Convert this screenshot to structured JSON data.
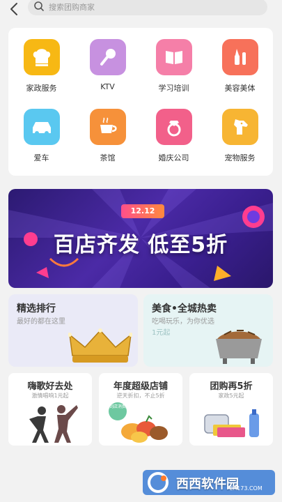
{
  "search": {
    "placeholder": "搜索团购商家"
  },
  "categories": [
    {
      "label": "家政服务",
      "icon": "chef-hat-icon",
      "color": "#f7b814"
    },
    {
      "label": "KTV",
      "icon": "microphone-icon",
      "color": "#c791e0"
    },
    {
      "label": "学习培训",
      "icon": "book-icon",
      "color": "#f57fa8"
    },
    {
      "label": "美容美体",
      "icon": "makeup-brush-icon",
      "color": "#f7715a"
    },
    {
      "label": "爱车",
      "icon": "car-icon",
      "color": "#5ac8f0"
    },
    {
      "label": "茶馆",
      "icon": "teacup-icon",
      "color": "#f6913a"
    },
    {
      "label": "婚庆公司",
      "icon": "diamond-ring-icon",
      "color": "#f2608a"
    },
    {
      "label": "宠物服务",
      "icon": "dog-icon",
      "color": "#f7b533"
    }
  ],
  "banner": {
    "date": "12.12",
    "title": "百店齐发 低至5折"
  },
  "featured": [
    {
      "title": "精选排行",
      "subtitle": "最好的都在这里",
      "icon": "crown-icon"
    },
    {
      "title": "美食•全城热卖",
      "subtitle": "吃喝玩乐，为你优选",
      "price": "1元起",
      "icon": "grill-food-icon"
    }
  ],
  "cards": [
    {
      "title": "嗨歌好去处",
      "subtitle": "激情唱响1元起",
      "icon": "singers-icon"
    },
    {
      "title": "年度超级店铺",
      "subtitle": "逆天折扣，不止5折",
      "badge": "到店消费",
      "icon": "fruit-icon"
    },
    {
      "title": "团购再5折",
      "subtitle": "家政5元起",
      "icon": "cleaning-supplies-icon"
    }
  ],
  "watermark": {
    "text": "西西软件园",
    "url": "CR173.COM"
  }
}
